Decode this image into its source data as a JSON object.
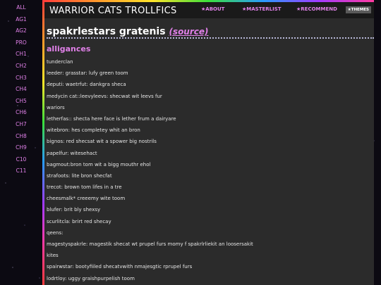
{
  "sidebar": {
    "items": [
      "ALL",
      "AG1",
      "AG2",
      "PRO",
      "CH1",
      "CH2",
      "CH3",
      "CH4",
      "CH5",
      "CH6",
      "CH7",
      "CH8",
      "CH9",
      "C10",
      "C11"
    ]
  },
  "header": {
    "site_title": "WARRIOR CATS TROLLFICS",
    "nav": {
      "about": "★ABOUT",
      "masterlist": "★MASTERLIST",
      "recommend": "★RECOMMEND"
    },
    "themes_label": "★THEMES"
  },
  "page": {
    "title": "spakrlestars gratenis",
    "source_link": "(source)",
    "section_heading": "alligances"
  },
  "entries": [
    "tunderclan",
    "leeder: grasstar: lufy green toom",
    "deputi: waetrfut: dankgra sheca",
    "medycin cat::leevyleevs: shecwat wit leevs fur",
    "wariors",
    "letherfas:: shecta here face is lether frum a dairyare",
    "witebron: hes completey whit an bron",
    "bignos: red shecsat wit a spower big nostrils",
    "papelfur: witesehact",
    "bagmout:bron tom wit a bigg mouthr ehol",
    "strafoots: lite bron shecfat",
    "trecot: brown tom lifes in a tre",
    "cheesmalk* creeemy wite toom",
    "blufer: brit bly shexsy",
    "scurlitcla: brirt red shecay",
    "qeens:",
    "magestyspakrle: magestik shecat wt prupel furs momy f spakrlrliekit an loosersakit",
    "kites",
    "spairwstar: bootyfiiled shecatvwith nmajesgtic rprupel furs",
    "lodrtloy: uggy graishpurpelish toom"
  ],
  "colors": {
    "accent": "#e080e8",
    "panel": "#2b2b2b",
    "header": "#1a1a1a",
    "background": "#0c0a12"
  }
}
